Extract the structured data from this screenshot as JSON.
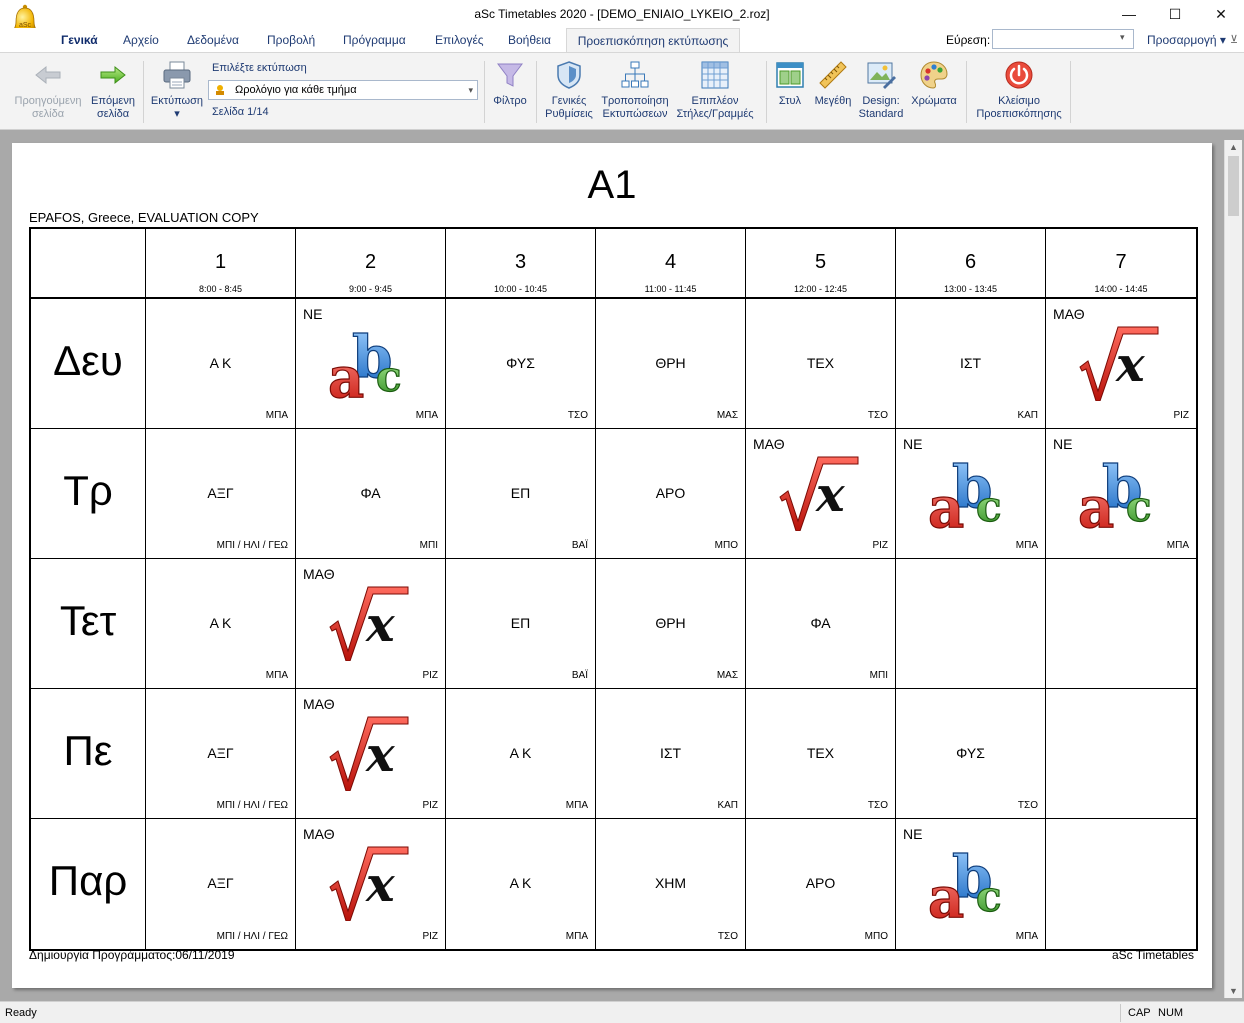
{
  "window": {
    "title": "aSc Timetables 2020  - [DEMO_ENIAIO_LYKEIO_2.roz]",
    "minimize": "—",
    "maximize": "☐",
    "close": "✕"
  },
  "menu": {
    "items": [
      "Γενικά",
      "Αρχείο",
      "Δεδομένα",
      "Προβολή",
      "Πρόγραμμα",
      "Επιλογές",
      "Βοήθεια"
    ],
    "active_tab": "Προεπισκόπηση εκτύπωσης",
    "find_label": "Εύρεση:",
    "find_value": "",
    "customize": "Προσαρμογή ▾",
    "pin": "⊻"
  },
  "ribbon": {
    "prev_page": [
      "Προηγούμενη",
      "σελίδα"
    ],
    "next_page": [
      "Επόμενη",
      "σελίδα"
    ],
    "print": [
      "Εκτύπωση",
      "▾"
    ],
    "select_label": "Επιλέξτε εκτύπωση",
    "select_value": "Ωρολόγιο για κάθε τμήμα",
    "select_arrow": "▾",
    "page_indicator": "Σελίδα 1/14",
    "filter": [
      "Φίλτρο"
    ],
    "general_settings": [
      "Γενικές",
      "Ρυθμίσεις"
    ],
    "modify_prints": [
      "Τροποποίηση",
      "Εκτυπώσεων"
    ],
    "more_cols_rows": [
      "Επιπλέον",
      "Στήλες/Γραμμές"
    ],
    "style": [
      "Στυλ"
    ],
    "size": [
      "Μεγέθη"
    ],
    "design": [
      "Design:",
      "Standard"
    ],
    "colors": [
      "Χρώματα"
    ],
    "close_preview": [
      "Κλείσιμο",
      "Προεπισκόπησης"
    ]
  },
  "scroll": {
    "up": "▲",
    "down": "▼"
  },
  "page": {
    "title": "Α1",
    "school_line": "EPAFOS, Greece, EVALUATION COPY",
    "footer_left": "Δημιουργία Προγράμματος:06/11/2019",
    "footer_right": "aSc Timetables"
  },
  "periods": [
    {
      "num": "1",
      "time": "8:00 - 8:45"
    },
    {
      "num": "2",
      "time": "9:00 - 9:45"
    },
    {
      "num": "3",
      "time": "10:00 - 10:45"
    },
    {
      "num": "4",
      "time": "11:00 - 11:45"
    },
    {
      "num": "5",
      "time": "12:00 - 12:45"
    },
    {
      "num": "6",
      "time": "13:00 - 13:45"
    },
    {
      "num": "7",
      "time": "14:00 - 14:45"
    }
  ],
  "days": [
    "Δευ",
    "Τρ",
    "Τετ",
    "Πε",
    "Παρ"
  ],
  "timetable": [
    [
      {
        "subject": "Α Κ",
        "teacher": "ΜΠΑ"
      },
      {
        "group": "ΝΕ",
        "icon": "abc",
        "teacher": "ΜΠΑ"
      },
      {
        "subject": "ΦΥΣ",
        "teacher": "ΤΣΟ"
      },
      {
        "subject": "ΘΡΗ",
        "teacher": "ΜΑΣ"
      },
      {
        "subject": "ΤΕΧ",
        "teacher": "ΤΣΟ"
      },
      {
        "subject": "ΙΣΤ",
        "teacher": "ΚΑΠ"
      },
      {
        "group": "ΜΑΘ",
        "icon": "sqrt",
        "teacher": "ΡΙΖ"
      }
    ],
    [
      {
        "subject": "ΑΞΓ",
        "teacher": "ΜΠΙ / ΗΛΙ / ΓΕΩ"
      },
      {
        "subject": "ΦΑ",
        "teacher": "ΜΠΙ"
      },
      {
        "subject": "ΕΠ",
        "teacher": "ΒΑΪ"
      },
      {
        "subject": "ΑΡΟ",
        "teacher": "ΜΠΟ"
      },
      {
        "group": "ΜΑΘ",
        "icon": "sqrt",
        "teacher": "ΡΙΖ"
      },
      {
        "group": "ΝΕ",
        "icon": "abc",
        "teacher": "ΜΠΑ"
      },
      {
        "group": "ΝΕ",
        "icon": "abc",
        "teacher": "ΜΠΑ"
      }
    ],
    [
      {
        "subject": "Α Κ",
        "teacher": "ΜΠΑ"
      },
      {
        "group": "ΜΑΘ",
        "icon": "sqrt",
        "teacher": "ΡΙΖ"
      },
      {
        "subject": "ΕΠ",
        "teacher": "ΒΑΪ"
      },
      {
        "subject": "ΘΡΗ",
        "teacher": "ΜΑΣ"
      },
      {
        "subject": "ΦΑ",
        "teacher": "ΜΠΙ"
      },
      {},
      {}
    ],
    [
      {
        "subject": "ΑΞΓ",
        "teacher": "ΜΠΙ / ΗΛΙ / ΓΕΩ"
      },
      {
        "group": "ΜΑΘ",
        "icon": "sqrt",
        "teacher": "ΡΙΖ"
      },
      {
        "subject": "Α Κ",
        "teacher": "ΜΠΑ"
      },
      {
        "subject": "ΙΣΤ",
        "teacher": "ΚΑΠ"
      },
      {
        "subject": "ΤΕΧ",
        "teacher": "ΤΣΟ"
      },
      {
        "subject": "ΦΥΣ",
        "teacher": "ΤΣΟ"
      },
      {}
    ],
    [
      {
        "subject": "ΑΞΓ",
        "teacher": "ΜΠΙ / ΗΛΙ / ΓΕΩ"
      },
      {
        "group": "ΜΑΘ",
        "icon": "sqrt",
        "teacher": "ΡΙΖ"
      },
      {
        "subject": "Α Κ",
        "teacher": "ΜΠΑ"
      },
      {
        "subject": "ΧΗΜ",
        "teacher": "ΤΣΟ"
      },
      {
        "subject": "ΑΡΟ",
        "teacher": "ΜΠΟ"
      },
      {
        "group": "ΝΕ",
        "icon": "abc",
        "teacher": "ΜΠΑ"
      },
      {}
    ]
  ],
  "status": {
    "text": "Ready",
    "cap": "CAP",
    "num": "NUM"
  },
  "colors": {
    "menu_text": "#1f3b73",
    "ribbon_bg": "#f3f3f3",
    "preview_bg": "#a9a9a9",
    "close_red": "#e94b3c"
  }
}
